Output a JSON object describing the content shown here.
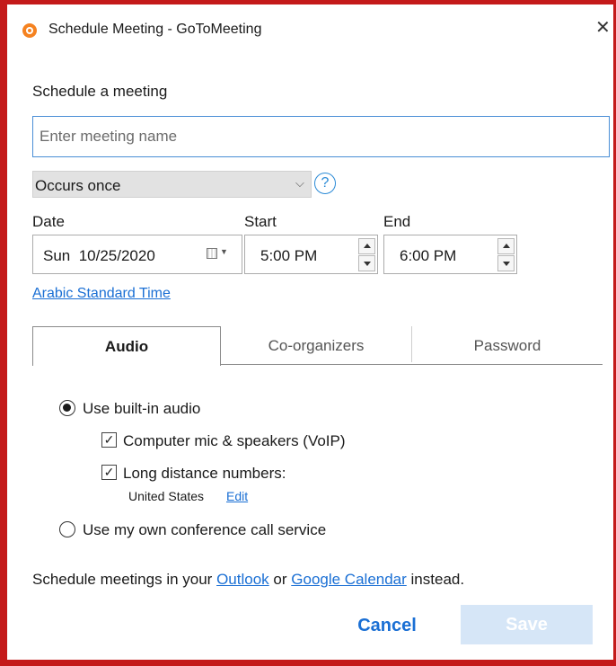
{
  "window": {
    "title": "Schedule Meeting - GoToMeeting",
    "close_label": "✕"
  },
  "form": {
    "heading": "Schedule a meeting",
    "name_placeholder": "Enter meeting name",
    "name_value": "",
    "recurrence": "Occurs once",
    "help_label": "?",
    "date_label": "Date",
    "date_value": "Sun  10/25/2020",
    "start_label": "Start",
    "start_value": "5:00 PM",
    "end_label": "End",
    "end_value": "6:00 PM",
    "timezone": "Arabic Standard Time"
  },
  "tabs": [
    {
      "label": "Audio",
      "selected": true
    },
    {
      "label": "Co-organizers",
      "selected": false
    },
    {
      "label": "Password",
      "selected": false
    }
  ],
  "audio": {
    "builtin_label": "Use built-in audio",
    "builtin_selected": true,
    "voip_label": "Computer mic & speakers (VoIP)",
    "voip_checked": true,
    "longdist_label": "Long distance numbers:",
    "longdist_checked": true,
    "country": "United States",
    "edit_label": "Edit",
    "own_label": "Use my own conference call service",
    "own_selected": false
  },
  "footer": {
    "prefix": "Schedule meetings in your",
    "outlook": "Outlook",
    "or": "or",
    "google": "Google Calendar",
    "suffix": "instead."
  },
  "buttons": {
    "cancel": "Cancel",
    "save": "Save"
  },
  "colors": {
    "accent": "#1a6fd4",
    "border_red": "#c41a1a",
    "save_disabled": "#d6e6f7"
  }
}
